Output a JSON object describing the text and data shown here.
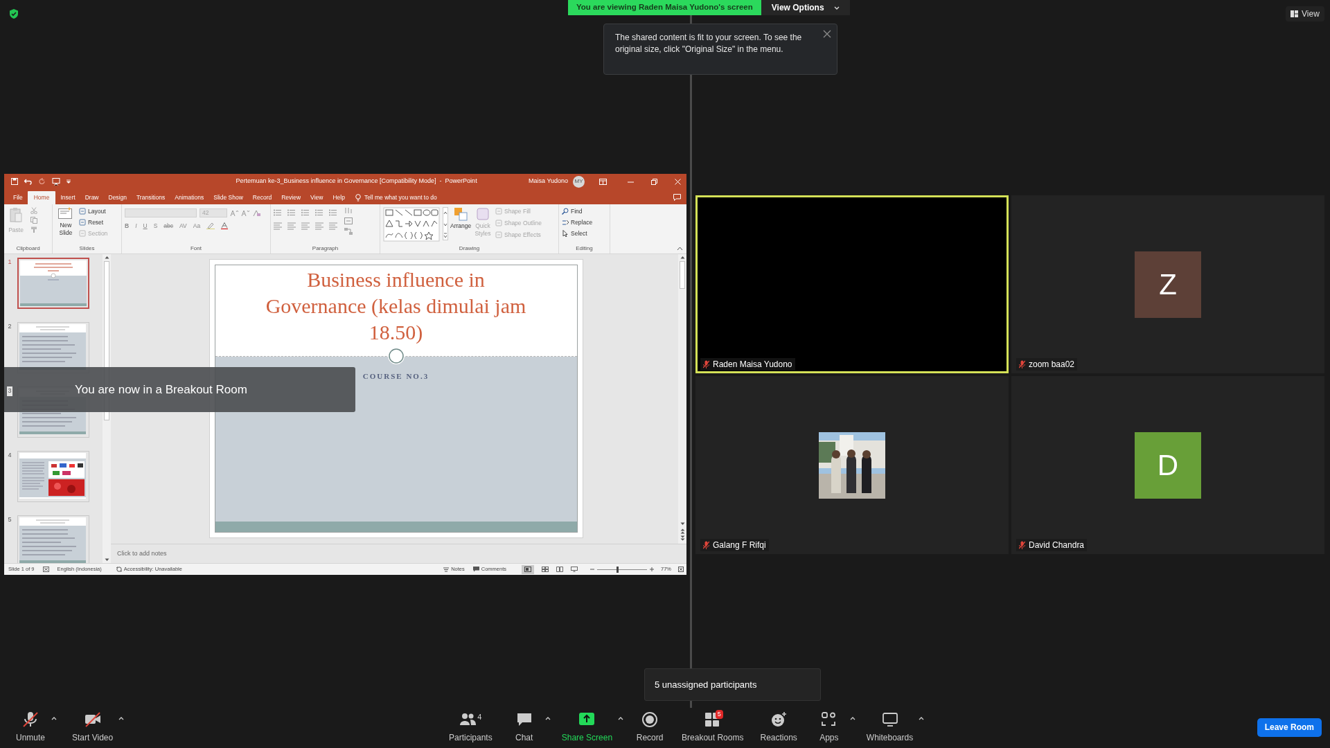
{
  "share_banner": {
    "text": "You are viewing Raden Maisa Yudono's screen",
    "view_options": "View Options"
  },
  "tooltip": {
    "text": "The shared content is fit to your screen. To see the original size, click \"Original Size\" in the menu."
  },
  "view_button": {
    "label": "View"
  },
  "powerpoint": {
    "title": "Pertemuan ke-3_Business influence in Governance [Compatibility Mode]  -  PowerPoint",
    "user": "Maisa Yudono",
    "initials": "MY",
    "tabs": [
      {
        "label": "File",
        "selected": false
      },
      {
        "label": "Home",
        "selected": true
      },
      {
        "label": "Insert",
        "selected": false
      },
      {
        "label": "Draw",
        "selected": false
      },
      {
        "label": "Design",
        "selected": false
      },
      {
        "label": "Transitions",
        "selected": false
      },
      {
        "label": "Animations",
        "selected": false
      },
      {
        "label": "Slide Show",
        "selected": false
      },
      {
        "label": "Record",
        "selected": false
      },
      {
        "label": "Review",
        "selected": false
      },
      {
        "label": "View",
        "selected": false
      },
      {
        "label": "Help",
        "selected": false
      }
    ],
    "tell_me": "Tell me what you want to do",
    "ribbon": [
      {
        "kind": "clipboard",
        "label": "Clipboard",
        "items": [
          {
            "label": "Paste",
            "disabled": true
          }
        ]
      },
      {
        "kind": "slides",
        "label": "Slides",
        "items": [
          {
            "label": "New Slide",
            "disabled": false
          },
          {
            "label": "Layout",
            "disabled": false
          },
          {
            "label": "Reset",
            "disabled": false
          },
          {
            "label": "Section",
            "disabled": true
          }
        ]
      },
      {
        "kind": "font",
        "label": "Font",
        "font_size": "42",
        "items": [
          {
            "label": "B"
          },
          {
            "label": "I"
          },
          {
            "label": "U"
          },
          {
            "label": "S"
          },
          {
            "label": "abc"
          },
          {
            "label": "AV"
          },
          {
            "label": "Aa"
          }
        ]
      },
      {
        "kind": "paragraph",
        "label": "Paragraph"
      },
      {
        "kind": "drawing",
        "label": "Drawing",
        "items": [
          {
            "label": "Arrange",
            "disabled": false
          },
          {
            "label": "Quick Styles",
            "disabled": true
          },
          {
            "label": "Shape Fill",
            "disabled": true
          },
          {
            "label": "Shape Outline",
            "disabled": true
          },
          {
            "label": "Shape Effects",
            "disabled": true
          }
        ]
      },
      {
        "kind": "editing",
        "label": "Editing",
        "items": [
          {
            "label": "Find",
            "disabled": false
          },
          {
            "label": "Replace",
            "disabled": false
          },
          {
            "label": "Select",
            "disabled": false
          }
        ]
      }
    ],
    "thumbnails": [
      {
        "number": "1",
        "selected": true
      },
      {
        "number": "2",
        "selected": false
      },
      {
        "number": "3",
        "selected": false
      },
      {
        "number": "4",
        "selected": false
      },
      {
        "number": "5",
        "selected": false
      }
    ],
    "slide": {
      "title": "Business influence in Governance (kelas dimulai jam 18.50)",
      "subtitle": "COURSE NO.3"
    },
    "notes_placeholder": "Click to add notes",
    "status": {
      "slide": "Slide 1 of 9",
      "language": "English (Indonesia)",
      "accessibility": "Accessibility: Unavailable",
      "notes": "Notes",
      "comments": "Comments",
      "zoom": "77%",
      "level": 0.4
    }
  },
  "breakout_notice": "You are now in a Breakout Room",
  "tiles": [
    {
      "name": "Raden Maisa Yudono",
      "kind": "video",
      "active_speaker": true,
      "muted": true
    },
    {
      "name": "zoom baa02",
      "kind": "avatar",
      "initial": "Z",
      "color": "#5d4037",
      "active_speaker": false,
      "muted": true
    },
    {
      "name": "Galang F Rifqi",
      "kind": "picture",
      "active_speaker": false,
      "muted": true
    },
    {
      "name": "David Chandra",
      "kind": "avatar",
      "initial": "D",
      "color": "#689f38",
      "active_speaker": false,
      "muted": true
    }
  ],
  "unassigned_popup": "5 unassigned participants",
  "toolbar": {
    "items": [
      {
        "label": "Unmute",
        "kind": "mic",
        "muted": true,
        "caret": true
      },
      {
        "label": "Start Video",
        "kind": "camera",
        "muted": true,
        "caret": true
      },
      {
        "label": "Participants",
        "kind": "participants",
        "count": "4",
        "caret": false
      },
      {
        "label": "Chat",
        "kind": "chat",
        "caret": true
      },
      {
        "label": "Share Screen",
        "kind": "share",
        "caret": true
      },
      {
        "label": "Record",
        "kind": "record",
        "caret": false
      },
      {
        "label": "Breakout Rooms",
        "kind": "breakout",
        "badge": "5",
        "caret": false
      },
      {
        "label": "Reactions",
        "kind": "reactions",
        "caret": false
      },
      {
        "label": "Apps",
        "kind": "apps",
        "caret": true
      },
      {
        "label": "Whiteboards",
        "kind": "whiteboard",
        "caret": true
      }
    ],
    "leave": "Leave Room"
  }
}
